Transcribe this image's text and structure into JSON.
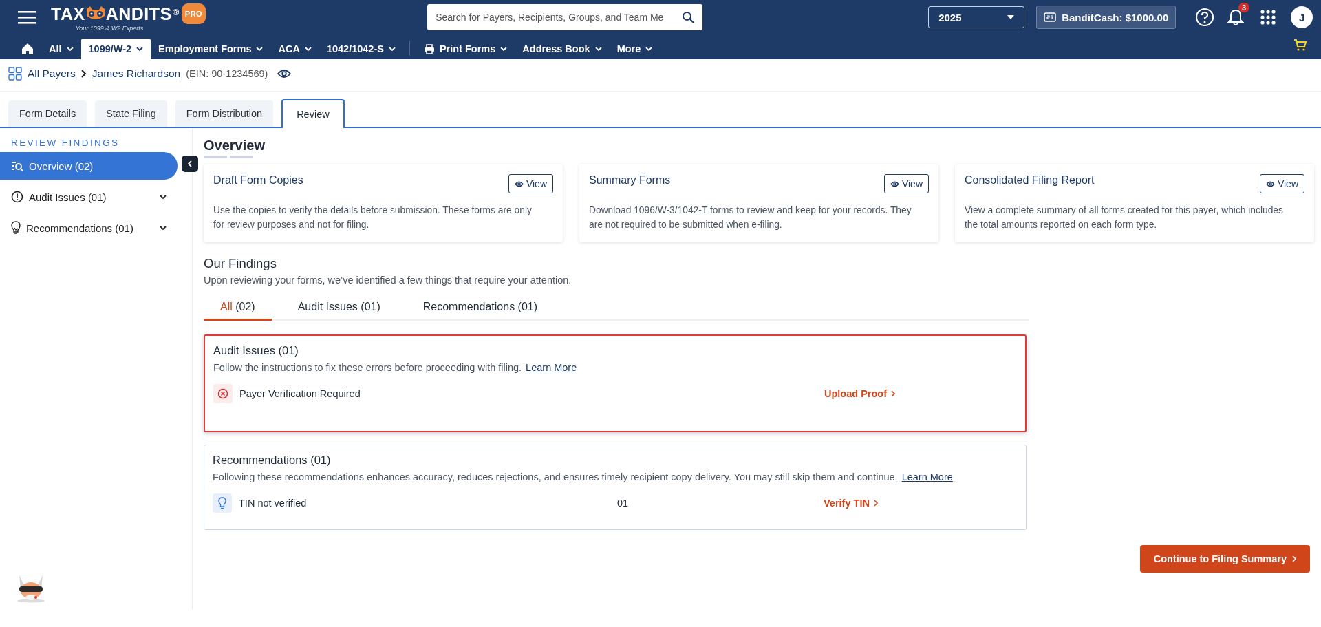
{
  "header": {
    "logo": {
      "left": "TAX",
      "right": "ANDITS",
      "mark": "®",
      "badge": "PRO",
      "tagline": "Your 1099 & W2 Experts"
    },
    "search": {
      "placeholder": "Search for Payers, Recipients, Groups, and Team Me"
    },
    "year": "2025",
    "bandit_cash": "BanditCash: $1000.00",
    "notifications": "3",
    "avatar": "J"
  },
  "nav": {
    "items": [
      {
        "kind": "home",
        "selected": false
      },
      {
        "kind": "menu",
        "label": "All",
        "selected": false
      },
      {
        "kind": "menu",
        "label": "1099/W-2",
        "selected": true
      },
      {
        "kind": "menu",
        "label": "Employment Forms",
        "selected": false
      },
      {
        "kind": "menu",
        "label": "ACA",
        "selected": false
      },
      {
        "kind": "menu",
        "label": "1042/1042-S",
        "selected": false
      },
      {
        "kind": "divider"
      },
      {
        "kind": "print",
        "label": "Print Forms",
        "selected": false
      },
      {
        "kind": "menu",
        "label": "Address Book",
        "selected": false
      },
      {
        "kind": "menu",
        "label": "More",
        "selected": false
      }
    ]
  },
  "breadcrumb": {
    "items": [
      "All Payers",
      "James Richardson"
    ],
    "ein": "(EIN: 90-1234569)"
  },
  "tabs": [
    {
      "label": "Form Details",
      "selected": false
    },
    {
      "label": "State Filing",
      "selected": false
    },
    {
      "label": "Form Distribution",
      "selected": false
    },
    {
      "label": "Review",
      "selected": true
    }
  ],
  "sidebar": {
    "heading": "REVIEW FINDINGS",
    "items": [
      {
        "kind": "overview",
        "label": "Overview (02)",
        "selected": true
      },
      {
        "kind": "audit",
        "label": "Audit Issues (01)",
        "selected": false,
        "expanded": false
      },
      {
        "kind": "recommendation",
        "label": "Recommendations (01)",
        "selected": false,
        "expanded": false
      }
    ]
  },
  "overview": {
    "title": "Overview",
    "cards": [
      {
        "title": "Draft Form Copies",
        "button": "View",
        "text": "Use the copies to verify the details before submission. These forms are only for review purposes and not for filing."
      },
      {
        "title": "Summary Forms",
        "button": "View",
        "text": "Download 1096/W-3/1042-T forms to review and keep for your records. They are not required to be submitted when e-filing."
      },
      {
        "title": "Consolidated Filing Report",
        "button": "View",
        "text": "View a complete summary of all forms created for this payer, which includes the total amounts reported on each form type."
      }
    ]
  },
  "findings": {
    "title": "Our Findings",
    "subtitle": "Upon reviewing your forms, we’ve identified a few things that require your attention.",
    "tabs": [
      {
        "label": "All",
        "count": "(02)",
        "selected": true
      },
      {
        "label": "Audit Issues",
        "count": "(01)",
        "selected": false
      },
      {
        "label": "Recommendations",
        "count": "(01)",
        "selected": false
      }
    ],
    "groups": [
      {
        "kind": "audit",
        "title": "Audit Issues (01)",
        "text": "Follow the instructions to fix these errors before proceeding with filing.",
        "link": "Learn More",
        "highlighted": true,
        "rows": [
          {
            "label": "Payer Verification Required",
            "action": "Upload Proof"
          }
        ]
      },
      {
        "kind": "recommendation",
        "title": "Recommendations (01)",
        "text": "Following these recommendations enhances accuracy, reduces rejections, and ensures timely recipient copy delivery. You may still skip them and continue.",
        "link": "Learn More",
        "highlighted": false,
        "rows": [
          {
            "label": "TIN not verified",
            "count": "01",
            "action": "Verify TIN"
          }
        ]
      }
    ]
  },
  "continue_button": "Continue to Filing Summary"
}
